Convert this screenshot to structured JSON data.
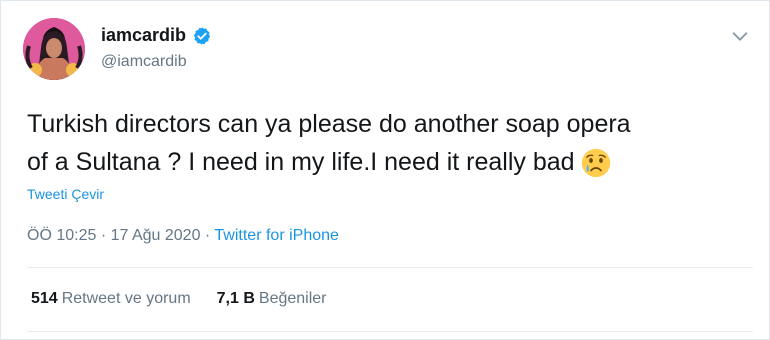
{
  "user": {
    "display_name": "iamcardib",
    "handle": "@iamcardib",
    "verified": true
  },
  "tweet": {
    "line1": "Turkish directors can ya please do another soap opera",
    "line2": "of a Sultana ? I need in my life.I need it really bad",
    "emoji": "crying-face"
  },
  "translate_label": "Tweeti Çevir",
  "meta": {
    "time": "ÖÖ 10:25",
    "separator1": " · ",
    "date": "17 Ağu 2020",
    "separator2": " · ",
    "source": "Twitter for iPhone"
  },
  "stats": {
    "retweets_count": "514",
    "retweets_label": "Retweet ve yorum",
    "likes_count": "7,1 B",
    "likes_label": "Beğeniler"
  },
  "colors": {
    "link": "#1b95e0",
    "secondary_text": "#657786",
    "primary_text": "#14171a"
  },
  "icons": [
    "verified-badge-icon",
    "chevron-down-icon",
    "crying-face-emoji"
  ]
}
